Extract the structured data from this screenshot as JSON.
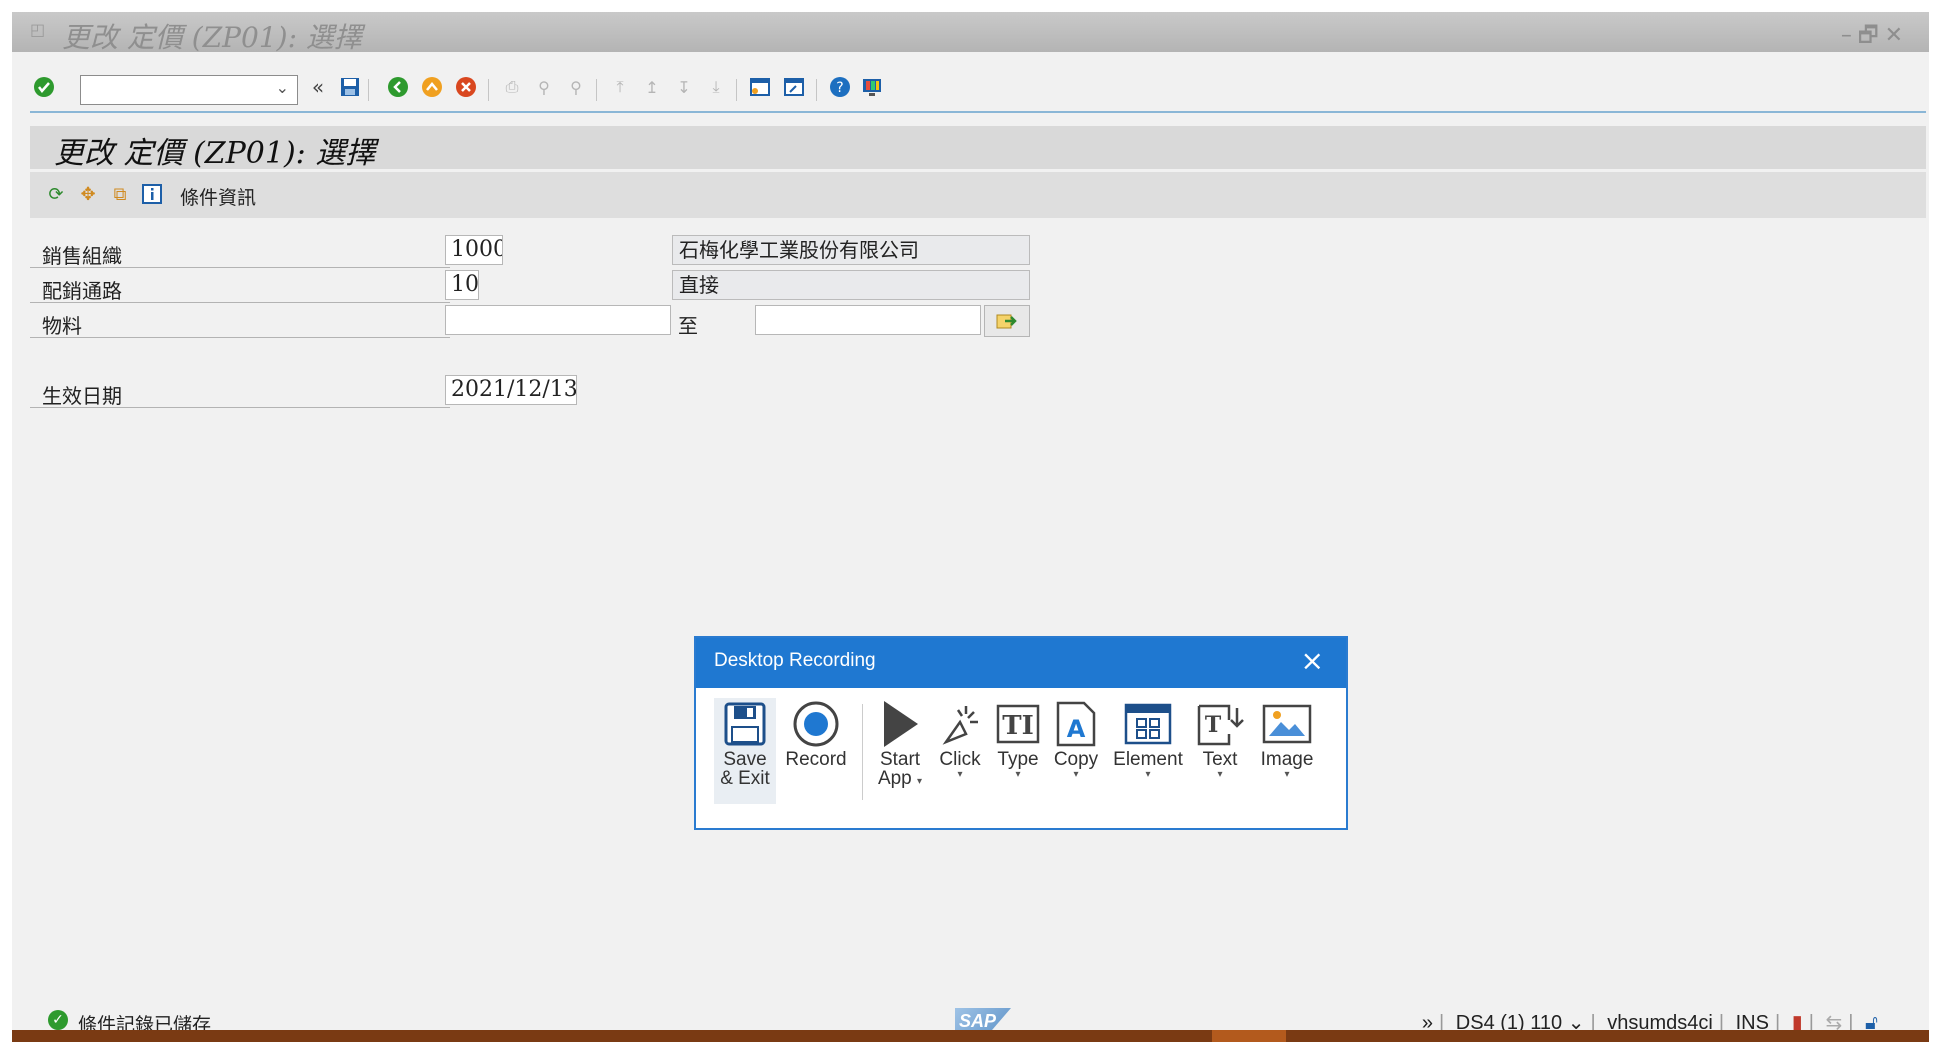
{
  "window": {
    "title": "更改 定價 (ZP01): 選擇",
    "controls": "–🗗✕"
  },
  "toolbar": {
    "command_value": "",
    "expand_glyph": "«"
  },
  "header": {
    "title": "更改 定價 (ZP01): 選擇"
  },
  "app_toolbar": {
    "condition_info_label": "條件資訊"
  },
  "form": {
    "sales_org": {
      "label": "銷售組織",
      "value": "1000",
      "description": "石梅化學工業股份有限公司"
    },
    "dist_channel": {
      "label": "配銷通路",
      "value": "10",
      "description": "直接"
    },
    "material": {
      "label": "物料",
      "value": "",
      "to_label": "至",
      "to_value": ""
    },
    "valid_on": {
      "label": "生效日期",
      "value": "2021/12/13"
    }
  },
  "dialog": {
    "title": "Desktop Recording",
    "buttons": {
      "save_exit": {
        "l1": "Save",
        "l2": "& Exit"
      },
      "record": {
        "l1": "Record"
      },
      "start_app": {
        "l1": "Start",
        "l2": "App"
      },
      "click": {
        "l1": "Click"
      },
      "type": {
        "l1": "Type"
      },
      "copy": {
        "l1": "Copy"
      },
      "element": {
        "l1": "Element"
      },
      "text": {
        "l1": "Text"
      },
      "image": {
        "l1": "Image"
      }
    }
  },
  "status": {
    "message": "條件記錄已儲存",
    "logo": "SAP",
    "system": "DS4 (1) 110",
    "server": "vhsumds4ci",
    "mode": "INS"
  },
  "colors": {
    "accent": "#1f78d1",
    "success": "#2e9a2e"
  }
}
